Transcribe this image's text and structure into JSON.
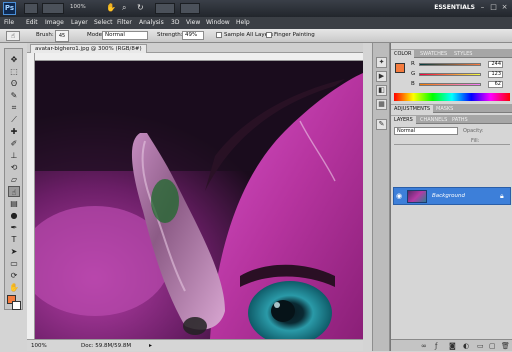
{
  "app": {
    "logo": "Ps",
    "zoom": "100%",
    "workspace": "ESSENTIALS"
  },
  "menu": [
    "File",
    "Edit",
    "Image",
    "Layer",
    "Select",
    "Filter",
    "Analysis",
    "3D",
    "View",
    "Window",
    "Help"
  ],
  "options": {
    "brush_label": "Brush:",
    "brush_size": "45",
    "mode_label": "Mode:",
    "mode_value": "Normal",
    "strength_label": "Strength:",
    "strength_value": "49%",
    "sample_all_layers": "Sample All Layers",
    "finger_painting": "Finger Painting"
  },
  "document": {
    "tab_title": "avatar-bighero1.jpg @ 300% (RGB/8#)",
    "zoom": "100%",
    "doc_info": "Doc: 59.8M/59.8M"
  },
  "color_panel": {
    "tabs": [
      "COLOR",
      "SWATCHES",
      "STYLES"
    ],
    "channels": [
      {
        "label": "R",
        "value": "244"
      },
      {
        "label": "G",
        "value": "123"
      },
      {
        "label": "B",
        "value": "62"
      }
    ],
    "foreground": "#f47b3e"
  },
  "adjustments_panel": {
    "tabs": [
      "ADJUSTMENTS",
      "MASKS"
    ]
  },
  "layers_panel": {
    "tabs": [
      "LAYERS",
      "CHANNELS",
      "PATHS"
    ],
    "blend_mode": "Normal",
    "opacity_label": "Opacity:",
    "fill_label": "Fill:",
    "layer_name": "Background"
  }
}
